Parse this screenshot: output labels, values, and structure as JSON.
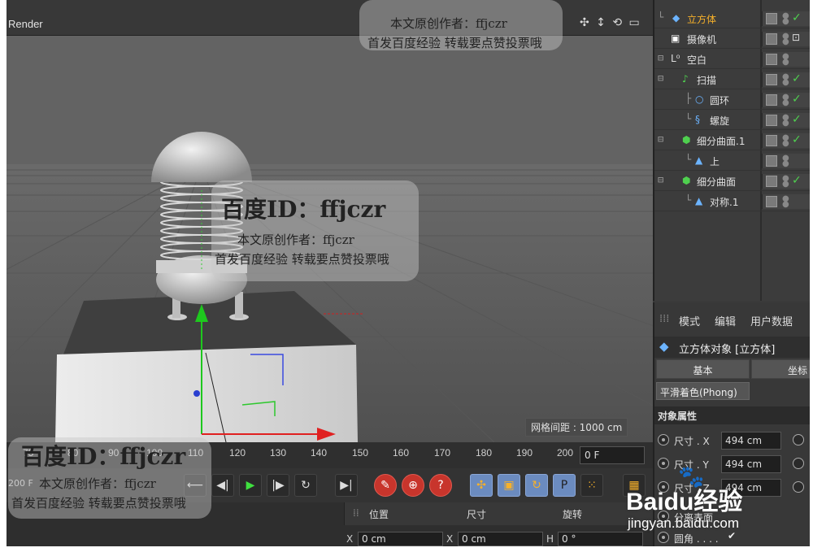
{
  "viewport": {
    "title": "Render",
    "nav_icons": "✣ ↕ ⟲ ▭",
    "grid_spacing": "网格间距 : 1000 cm"
  },
  "timeline": {
    "ticks": [
      "75",
      "80",
      "90",
      "100",
      "110",
      "120",
      "130",
      "140",
      "150",
      "160",
      "170",
      "180",
      "190",
      "200"
    ],
    "frame_field": "0 F",
    "start_frame": "200 F"
  },
  "transport": {
    "buttons": [
      "⟵",
      "◀|",
      "▶",
      "|▶",
      "↻",
      "▶|"
    ],
    "record_buttons": [
      "✎",
      "⊕",
      "?"
    ],
    "tool_buttons": [
      "✣",
      "▣",
      "↻",
      "P",
      "⁙"
    ]
  },
  "coords": {
    "headers": [
      "位置",
      "尺寸",
      "旋转"
    ],
    "x_label": "X",
    "x_value": "0 cm",
    "x2_label": "X",
    "x2_value": "0 cm",
    "h_label": "H",
    "h_value": "0 °"
  },
  "objects": [
    {
      "name": "立方体",
      "icon": "cube",
      "highlight": true,
      "check": true
    },
    {
      "name": "摄像机",
      "icon": "camera",
      "highlight": false,
      "check": false
    },
    {
      "name": "空白",
      "icon": "null",
      "highlight": false,
      "check": false
    },
    {
      "name": "扫描",
      "icon": "sweep",
      "highlight": false,
      "check": true
    },
    {
      "name": "圆环",
      "icon": "circle",
      "highlight": false,
      "check": true
    },
    {
      "name": "螺旋",
      "icon": "helix",
      "highlight": false,
      "check": true
    },
    {
      "name": "细分曲面.1",
      "icon": "subdiv",
      "highlight": false,
      "check": true
    },
    {
      "name": "上",
      "icon": "symmetry",
      "highlight": false,
      "check": false
    },
    {
      "name": "细分曲面",
      "icon": "subdiv",
      "highlight": false,
      "check": true
    },
    {
      "name": "对称.1",
      "icon": "symmetry",
      "highlight": false,
      "check": false
    }
  ],
  "attributes": {
    "menu": [
      "模式",
      "编辑",
      "用户数据"
    ],
    "title": "立方体对象 [立方体]",
    "tabs": [
      "基本",
      "坐标"
    ],
    "phong": "平滑着色(Phong)",
    "section": "对象属性",
    "rows": [
      {
        "label": "尺寸 . X",
        "value": "494 cm"
      },
      {
        "label": "尺寸 . Y",
        "value": "494 cm"
      },
      {
        "label": "尺寸 . Z",
        "value": "494 cm"
      }
    ],
    "fillet_label": "圆角 . . . .",
    "fillet_check": "✔",
    "separate_label": "分离表面"
  },
  "watermarks": {
    "baidu_id": "百度ID：ffjczr",
    "author": "本文原创作者：ffjczr",
    "note": "首发百度经验 转载要点赞投票哦",
    "baidu_logo": "Baidu经验",
    "site": "jingyan.baidu.com"
  },
  "colors": {
    "accent_orange": "#f7b12a",
    "check_green": "#4fd04f",
    "record_red": "#c8352c"
  }
}
